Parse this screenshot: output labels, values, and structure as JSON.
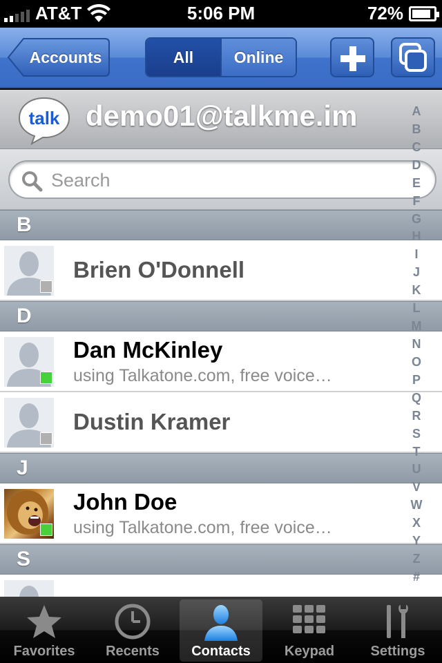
{
  "status_bar": {
    "carrier": "AT&T",
    "time": "5:06 PM",
    "battery": "72%",
    "battery_level": 0.72,
    "signal_bars": 2
  },
  "nav": {
    "back_label": "Accounts",
    "segments": [
      {
        "label": "All",
        "selected": true
      },
      {
        "label": "Online",
        "selected": false
      }
    ],
    "add_icon": "plus-icon",
    "windows_icon": "windows-icon"
  },
  "account": {
    "logo_text": "talk",
    "name": "demo01@talkme.im"
  },
  "search": {
    "placeholder": "Search",
    "value": ""
  },
  "sections": [
    {
      "letter": "B",
      "contacts": [
        {
          "name": "Brien O'Donnell",
          "status_message": "",
          "presence": "offline",
          "photo": false
        }
      ]
    },
    {
      "letter": "D",
      "contacts": [
        {
          "name": "Dan McKinley",
          "status_message": "using Talkatone.com, free voice…",
          "presence": "online",
          "photo": false
        },
        {
          "name": "Dustin Kramer",
          "status_message": "",
          "presence": "offline",
          "photo": false
        }
      ]
    },
    {
      "letter": "J",
      "contacts": [
        {
          "name": "John Doe",
          "status_message": "using Talkatone.com, free voice…",
          "presence": "online",
          "photo": true
        }
      ]
    },
    {
      "letter": "S",
      "contacts": []
    }
  ],
  "index_letters": [
    "A",
    "B",
    "C",
    "D",
    "E",
    "F",
    "G",
    "H",
    "I",
    "J",
    "K",
    "L",
    "M",
    "N",
    "O",
    "P",
    "Q",
    "R",
    "S",
    "T",
    "U",
    "V",
    "W",
    "X",
    "Y",
    "Z",
    "#"
  ],
  "tabs": [
    {
      "label": "Favorites",
      "icon": "star-icon",
      "active": false
    },
    {
      "label": "Recents",
      "icon": "clock-icon",
      "active": false
    },
    {
      "label": "Contacts",
      "icon": "contacts-icon",
      "active": true
    },
    {
      "label": "Keypad",
      "icon": "keypad-icon",
      "active": false
    },
    {
      "label": "Settings",
      "icon": "settings-icon",
      "active": false
    }
  ],
  "colors": {
    "nav_blue": "#3f73cc",
    "online": "#47d13b",
    "offline": "#b0b0b0",
    "index_text": "#7b8594"
  }
}
